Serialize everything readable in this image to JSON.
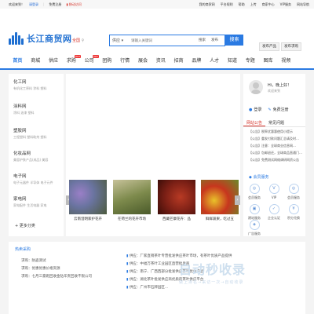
{
  "topbar": {
    "welcome": "欢迎来到！",
    "login": "请登录",
    "register": "免费注册",
    "mobile": "移动访问",
    "right_links": [
      "我的商贸网",
      "平台规则",
      "帮助",
      "上传",
      "商家中心",
      "VIP服务",
      "网站导航"
    ]
  },
  "header": {
    "logo_text": "长江商贸网",
    "city": "全国",
    "search": {
      "category": "供应",
      "placeholder": "请输入关键词",
      "opt1": "搜索",
      "opt2": "发布",
      "button": "搜索"
    },
    "publish_supply": "发布产品",
    "publish_buy": "发布求购"
  },
  "nav": {
    "items": [
      "首页",
      "商城",
      "供应",
      "求购",
      "公司",
      "团购",
      "行情",
      "展会",
      "资讯",
      "招商",
      "品牌",
      "人才",
      "知道",
      "专题",
      "图库",
      "视频"
    ],
    "badge_hot": "HOT"
  },
  "categories": [
    {
      "title": "化工网",
      "sub": "有机化工原料 涂料 塑料"
    },
    {
      "title": "涂料网",
      "sub": "涂料 油漆 塑料"
    },
    {
      "title": "塑胶网",
      "sub": "工程塑料 塑料助剂 塑料"
    },
    {
      "title": "化妆品网",
      "sub": "美容护肤产品(成品) 美容"
    },
    {
      "title": "电子网",
      "sub": "电子元器件 半导体 电子元件"
    },
    {
      "title": "家电网",
      "sub": "家电配件 生活电器 家电"
    }
  ],
  "more_categories": "更多分类",
  "carousel": [
    {
      "caption": "云南澄明家护花卉",
      "color": "#6a74a0"
    },
    {
      "caption": "在荷兰的花卉市场",
      "color": "#7d8a4c"
    },
    {
      "caption": "西藏芒康花卉：品",
      "color": "#7a1f15"
    },
    {
      "caption": "鲜鲜蔬果，吃过五",
      "color": "#c7361e"
    }
  ],
  "user": {
    "hello": "Hi，晚上好！",
    "welcome": "欢迎来到",
    "login": "登录",
    "register": "免费注册"
  },
  "tabs": [
    "网站公告",
    "常见问题"
  ],
  "news": [
    "【公告】税率优惠惠使用小提示",
    "【公告】重发付款问题汇总请及时…",
    "【公告】注意：全球商业信息网…",
    "【公告】包邮退还，全球商品直通门…",
    "【公告】免费测试网络调研网资公告"
  ],
  "services": {
    "title": "会员服务",
    "items": [
      "会员服务",
      "VIP",
      "会员服务",
      "建站服务",
      "企业认证",
      "积分兑换",
      "广告服务"
    ]
  },
  "bottom": {
    "title": "热卖采购",
    "left": [
      "求购：防盗测试",
      "求购：优惠优惠价格资源",
      "求购：七月三豪跑回收金钻华贵回收不限公司"
    ],
    "right": [
      {
        "tag": "供应：",
        "text": "厂家直销茶叶专营批发供应茶叶市场，有茶叶优质产品提供"
      },
      {
        "tag": "供应：",
        "text": "中福万茶叶工业园区直营批发商"
      },
      {
        "tag": "供应：",
        "text": "南宁、广西西部分批发供应茶叶优秀产品"
      },
      {
        "tag": "供应：",
        "text": "湖北茶叶批发供应商优质的茶叶供应平台"
      },
      {
        "tag": "供应：",
        "text": "广州市石牌园区…"
      }
    ]
  },
  "watermark": {
    "big": "自动秒收录",
    "sub": "做上排名→来访一次→自动收录"
  }
}
